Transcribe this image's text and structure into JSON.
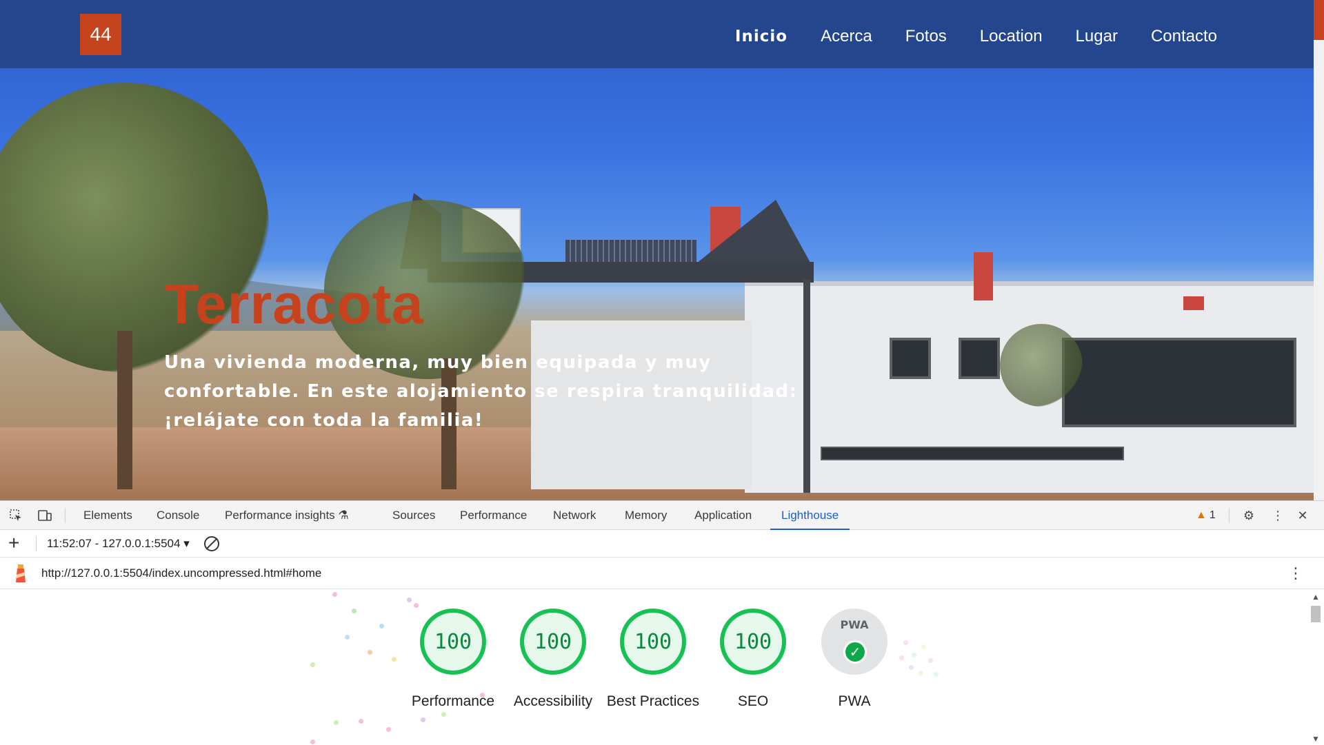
{
  "site": {
    "logo_text": "44",
    "nav": [
      "Inicio",
      "Acerca",
      "Fotos",
      "Location",
      "Lugar",
      "Contacto"
    ],
    "hero_title": "Terracota",
    "hero_subtitle": "Una vivienda moderna, muy bien equipada y muy confortable. En este alojamiento se respira tranquilidad: ¡relájate con toda la familia!",
    "colors": {
      "topbar": "#24468f",
      "accent": "#c5441d"
    }
  },
  "devtools": {
    "tabs": [
      "Elements",
      "Console",
      "Performance insights",
      "Sources",
      "Performance",
      "Network",
      "Memory",
      "Application",
      "Lighthouse"
    ],
    "active_tab": "Lighthouse",
    "warning_count": "1",
    "report_selector": "11:52:07 - 127.0.0.1:5504",
    "url": "http://127.0.0.1:5504/index.uncompressed.html#home",
    "scores": [
      {
        "label": "Performance",
        "value": "100"
      },
      {
        "label": "Accessibility",
        "value": "100"
      },
      {
        "label": "Best Practices",
        "value": "100"
      },
      {
        "label": "SEO",
        "value": "100"
      }
    ],
    "pwa": {
      "label": "PWA",
      "badge_text": "PWA"
    },
    "colors": {
      "pass": "#18c154",
      "active_tab": "#1a5fd0"
    }
  }
}
